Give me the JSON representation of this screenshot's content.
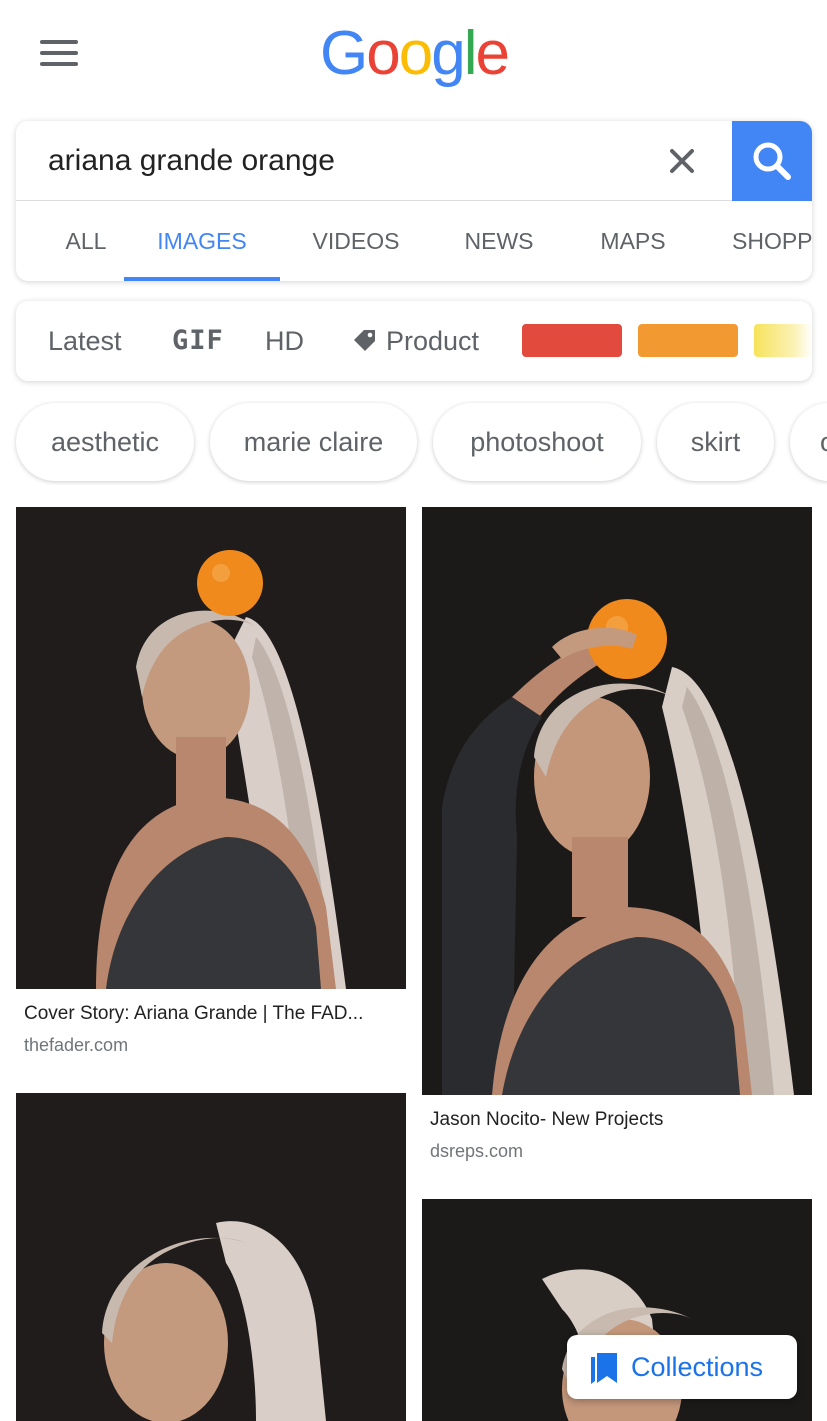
{
  "header": {
    "logo_letters": [
      {
        "ch": "G",
        "color": "#4285f4"
      },
      {
        "ch": "o",
        "color": "#ea4335"
      },
      {
        "ch": "o",
        "color": "#fbbc05"
      },
      {
        "ch": "g",
        "color": "#4285f4"
      },
      {
        "ch": "l",
        "color": "#34a853"
      },
      {
        "ch": "e",
        "color": "#ea4335"
      }
    ],
    "menu_icon": "hamburger-menu-icon"
  },
  "search": {
    "query": "ariana grande orange",
    "clear_icon": "close-icon",
    "search_icon": "magnifier-icon",
    "accent": "#4285f4"
  },
  "tabs": [
    {
      "label": "ALL",
      "active": false
    },
    {
      "label": "IMAGES",
      "active": true
    },
    {
      "label": "VIDEOS",
      "active": false
    },
    {
      "label": "NEWS",
      "active": false
    },
    {
      "label": "MAPS",
      "active": false
    },
    {
      "label": "SHOPPING",
      "active": false
    }
  ],
  "filters": {
    "latest": "Latest",
    "gif": "GIF",
    "hd": "HD",
    "product": "Product",
    "product_icon": "tag-icon",
    "colors": [
      "#e24a3d",
      "#f29a31",
      "#f6e35a"
    ]
  },
  "chips": [
    "aesthetic",
    "marie claire",
    "photoshoot",
    "skirt",
    "o"
  ],
  "results": [
    {
      "caption": "Cover Story: Ariana Grande | The FAD...",
      "source": "thefader.com"
    },
    {
      "caption": "Jason Nocito- New Projects",
      "source": "dsreps.com"
    },
    {
      "caption": "",
      "source": ""
    },
    {
      "caption": "",
      "source": ""
    }
  ],
  "collections": {
    "label": "Collections",
    "icon": "bookmarks-icon"
  }
}
